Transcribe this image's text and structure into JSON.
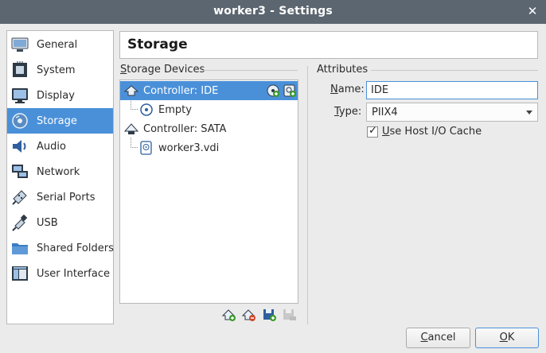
{
  "window": {
    "title": "worker3 - Settings"
  },
  "sidebar": {
    "items": [
      {
        "label": "General",
        "icon": "general-icon"
      },
      {
        "label": "System",
        "icon": "system-icon"
      },
      {
        "label": "Display",
        "icon": "display-icon"
      },
      {
        "label": "Storage",
        "icon": "storage-icon",
        "active": true
      },
      {
        "label": "Audio",
        "icon": "audio-icon"
      },
      {
        "label": "Network",
        "icon": "network-icon"
      },
      {
        "label": "Serial Ports",
        "icon": "serial-ports-icon"
      },
      {
        "label": "USB",
        "icon": "usb-icon"
      },
      {
        "label": "Shared Folders",
        "icon": "shared-folders-icon"
      },
      {
        "label": "User Interface",
        "icon": "user-interface-icon"
      }
    ]
  },
  "page": {
    "title": "Storage"
  },
  "storage_devices": {
    "label_first": "S",
    "label_rest": "torage Devices",
    "tree": [
      {
        "label": "Controller: IDE",
        "type": "controller",
        "selected": true
      },
      {
        "label": "Empty",
        "type": "optical"
      },
      {
        "label": "Controller: SATA",
        "type": "controller"
      },
      {
        "label": "worker3.vdi",
        "type": "disk"
      }
    ]
  },
  "attributes": {
    "label": "Attributes",
    "name_label_first": "N",
    "name_label_rest": "ame:",
    "name_value": "IDE",
    "type_label_first": "T",
    "type_label_rest": "ype:",
    "type_value": "PIIX4",
    "host_io_cache_label_first": "U",
    "host_io_cache_label_rest": "se Host I/O Cache",
    "host_io_cache_checked": true
  },
  "buttons": {
    "cancel_first": "C",
    "cancel_rest": "ancel",
    "ok_first": "O",
    "ok_rest": "K"
  },
  "colors": {
    "accent": "#4a90d9",
    "titlebar": "#5c6670",
    "add_green": "#3a9a2a"
  }
}
